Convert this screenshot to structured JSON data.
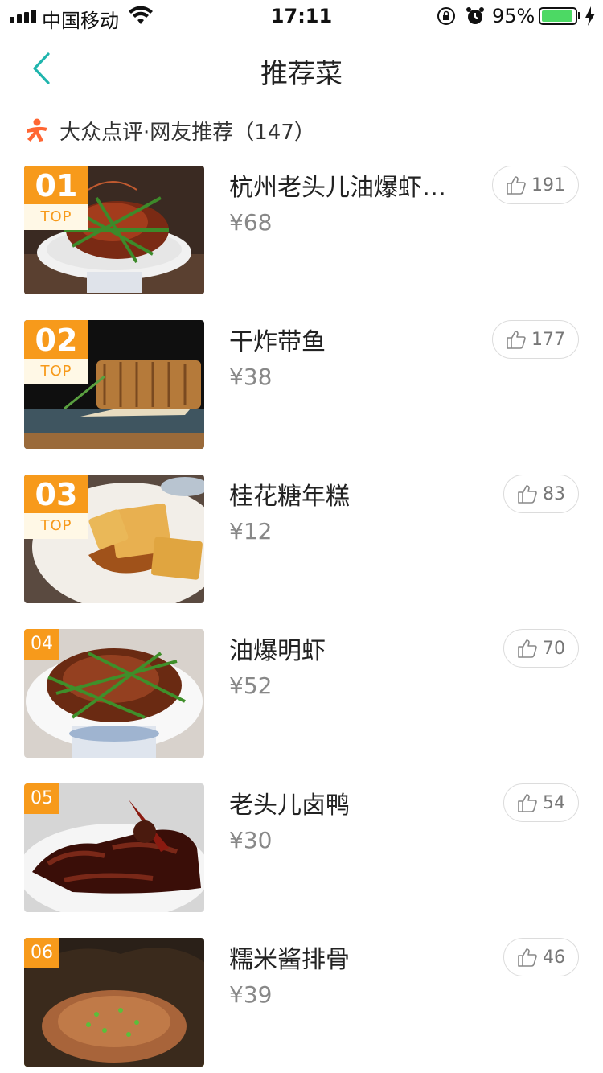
{
  "status_bar": {
    "carrier": "中国移动",
    "time": "17:11",
    "battery_percent": "95%",
    "battery_level": 0.95
  },
  "nav": {
    "title": "推荐菜"
  },
  "source": {
    "text": "大众点评·网友推荐（147）"
  },
  "dishes": [
    {
      "rank": "01",
      "top_label": "TOP",
      "name": "杭州老头儿油爆虾…",
      "price": "¥68",
      "likes": "191"
    },
    {
      "rank": "02",
      "top_label": "TOP",
      "name": "干炸带鱼",
      "price": "¥38",
      "likes": "177"
    },
    {
      "rank": "03",
      "top_label": "TOP",
      "name": "桂花糖年糕",
      "price": "¥12",
      "likes": "83"
    },
    {
      "rank": "04",
      "name": "油爆明虾",
      "price": "¥52",
      "likes": "70"
    },
    {
      "rank": "05",
      "name": "老头儿卤鸭",
      "price": "¥30",
      "likes": "54"
    },
    {
      "rank": "06",
      "name": "糯米酱排骨",
      "price": "¥39",
      "likes": "46"
    }
  ],
  "colors": {
    "accent_teal": "#1fb5ad",
    "rank_orange": "#f79a1b",
    "logo_orange": "#ff6633"
  },
  "icons": {
    "back": "chevron-left-icon",
    "like": "thumbs-up-icon",
    "logo": "dianping-logo"
  }
}
